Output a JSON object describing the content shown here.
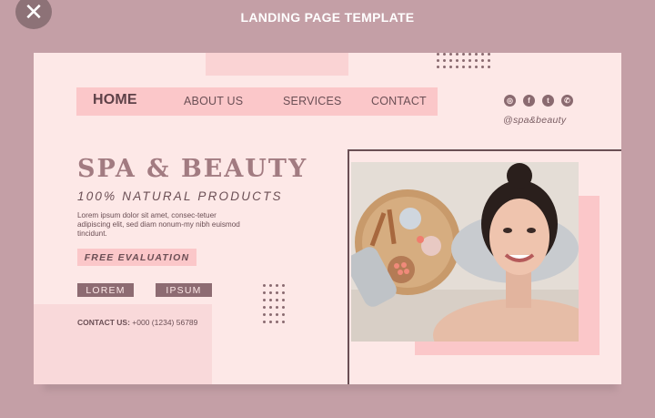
{
  "top_bar": {
    "title": "LANDING PAGE TEMPLATE",
    "close_label": "✕"
  },
  "nav": {
    "items": [
      {
        "label": "HOME"
      },
      {
        "label": "ABOUT US"
      },
      {
        "label": "SERVICES"
      },
      {
        "label": "CONTACT"
      }
    ]
  },
  "social": {
    "icons": [
      "instagram-icon",
      "facebook-icon",
      "twitter-icon",
      "whatsapp-icon"
    ],
    "glyphs": [
      "◎",
      "f",
      "t",
      "✆"
    ],
    "handle": "@spa&beauty"
  },
  "hero": {
    "headline": "SPA & BEAUTY",
    "subhead": "100% NATURAL PRODUCTS",
    "body": "Lorem ipsum dolor sit amet, consec-tetuer adipiscing elit, sed diam nonum-my nibh euismod tincidunt.",
    "cta": "FREE EVALUATION",
    "tags": [
      "LOREM",
      "IPSUM"
    ],
    "contact_label": "CONTACT US:",
    "contact_value": "+000 (1234) 56789"
  },
  "colors": {
    "background": "#c49fa6",
    "card": "#fde8e7",
    "accent_pink": "#fbc7c9",
    "accent_mauve": "#8d6b72",
    "headline": "#a27b81"
  }
}
